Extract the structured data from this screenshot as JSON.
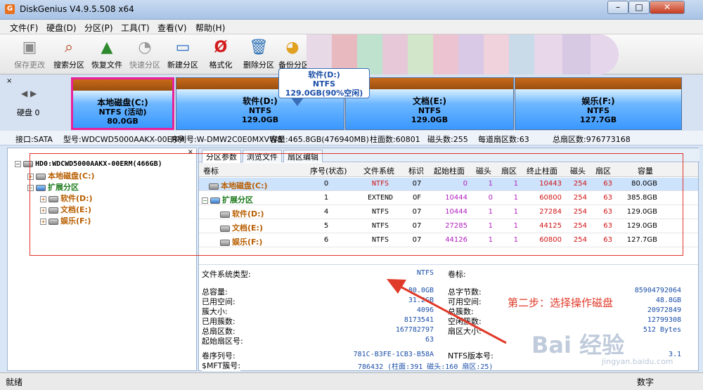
{
  "window": {
    "title": "DiskGenius V4.9.5.508 x64",
    "app_icon": "G",
    "minimize": "–",
    "maximize": "□",
    "close": "✕"
  },
  "menu": [
    "文件(F)",
    "硬盘(D)",
    "分区(P)",
    "工具(T)",
    "查看(V)",
    "帮助(H)"
  ],
  "toolbar": [
    {
      "label": "保存更改",
      "icon": "save-icon",
      "enabled": false
    },
    {
      "label": "搜索分区",
      "icon": "search-icon",
      "enabled": true
    },
    {
      "label": "恢复文件",
      "icon": "recover-file-icon",
      "enabled": true
    },
    {
      "label": "快速分区",
      "icon": "quick-partition-icon",
      "enabled": false
    },
    {
      "label": "新建分区",
      "icon": "new-partition-icon",
      "enabled": true
    },
    {
      "label": "格式化",
      "icon": "format-icon",
      "enabled": true
    },
    {
      "label": "删除分区",
      "icon": "delete-partition-icon",
      "enabled": true
    },
    {
      "label": "备份分区",
      "icon": "backup-partition-icon",
      "enabled": true
    }
  ],
  "disk_map": {
    "close": "×",
    "arrows": "◀ ▶",
    "disk_label": "硬盘 0",
    "partitions": [
      {
        "name": "本地磁盘(C:)",
        "fs": "NTFS (活动)",
        "size": "80.0GB",
        "selected": true
      },
      {
        "name": "软件(D:)",
        "fs": "NTFS",
        "size": "129.0GB",
        "selected": false
      },
      {
        "name": "文档(E:)",
        "fs": "NTFS",
        "size": "129.0GB",
        "selected": false
      },
      {
        "name": "娱乐(F:)",
        "fs": "NTFS",
        "size": "127.7GB",
        "selected": false
      }
    ],
    "tooltip": {
      "line1": "软件(D:)",
      "line2": "NTFS",
      "line3": "129.0GB(90%空闲)"
    }
  },
  "disk_info": {
    "iface": "接口:SATA",
    "model": "型号:WDCWD5000AAKX-00ERM",
    "serial": "序列号:W-DMW2C0E0MXVW8",
    "capacity": "容量:465.8GB(476940MB)",
    "cylinders": "柱面数:60801",
    "heads": "磁头数:255",
    "spt": "每道扇区数:63",
    "total_sectors": "总扇区数:976773168"
  },
  "tree": {
    "close": "×",
    "root": "HD0:WDCWD5000AAKX-00ERM(466GB)",
    "items": [
      {
        "label": "本地磁盘(C:)",
        "level": 1,
        "expander": "+"
      },
      {
        "label": "扩展分区",
        "level": 1,
        "expander": "−"
      },
      {
        "label": "软件(D:)",
        "level": 2,
        "expander": "+"
      },
      {
        "label": "文档(E:)",
        "level": 2,
        "expander": "+"
      },
      {
        "label": "娱乐(F:)",
        "level": 2,
        "expander": "+"
      }
    ]
  },
  "tabs": [
    "分区参数",
    "浏览文件",
    "扇区编辑"
  ],
  "grid": {
    "headers": [
      "卷标",
      "序号(状态)",
      "文件系统",
      "标识",
      "起始柱面",
      "磁头",
      "扇区",
      "终止柱面",
      "磁头",
      "扇区",
      "容量"
    ],
    "rows": [
      {
        "label": "本地磁盘(C:)",
        "indent": 0,
        "index": "0",
        "fs": "NTFS",
        "id": "07",
        "start_cyl": "0",
        "start_head": "1",
        "start_sec": "1",
        "end_cyl": "10443",
        "end_head": "254",
        "end_sec": "63",
        "size": "80.0GB",
        "selected": true
      },
      {
        "label": "扩展分区",
        "indent": 0,
        "index": "1",
        "fs": "EXTEND",
        "id": "0F",
        "start_cyl": "10444",
        "start_head": "0",
        "start_sec": "1",
        "end_cyl": "60800",
        "end_head": "254",
        "end_sec": "63",
        "size": "385.8GB",
        "selected": false
      },
      {
        "label": "软件(D:)",
        "indent": 1,
        "index": "4",
        "fs": "NTFS",
        "id": "07",
        "start_cyl": "10444",
        "start_head": "1",
        "start_sec": "1",
        "end_cyl": "27284",
        "end_head": "254",
        "end_sec": "63",
        "size": "129.0GB",
        "selected": false
      },
      {
        "label": "文档(E:)",
        "indent": 1,
        "index": "5",
        "fs": "NTFS",
        "id": "07",
        "start_cyl": "27285",
        "start_head": "1",
        "start_sec": "1",
        "end_cyl": "44125",
        "end_head": "254",
        "end_sec": "63",
        "size": "129.0GB",
        "selected": false
      },
      {
        "label": "娱乐(F:)",
        "indent": 1,
        "index": "6",
        "fs": "NTFS",
        "id": "07",
        "start_cyl": "44126",
        "start_head": "1",
        "start_sec": "1",
        "end_cyl": "60800",
        "end_head": "254",
        "end_sec": "63",
        "size": "127.7GB",
        "selected": false
      }
    ]
  },
  "details": {
    "fs_type_label": "文件系统类型:",
    "fs_type": "NTFS",
    "volume_label": "卷标:",
    "left": [
      {
        "k": "总容量:",
        "v": "80.0GB"
      },
      {
        "k": "已用空间:",
        "v": "31.2GB"
      },
      {
        "k": "簇大小:",
        "v": "4096"
      },
      {
        "k": "已用簇数:",
        "v": "8173541"
      },
      {
        "k": "总扇区数:",
        "v": "167782797"
      },
      {
        "k": "起始扇区号:",
        "v": "63"
      }
    ],
    "right": [
      {
        "k": "总字节数:",
        "v": "85904792064"
      },
      {
        "k": "可用空间:",
        "v": "48.8GB"
      },
      {
        "k": "总簇数:",
        "v": "20972849"
      },
      {
        "k": "空闲簇数:",
        "v": "12799308"
      },
      {
        "k": "扇区大小:",
        "v": "512 Bytes"
      }
    ],
    "serial_label": "卷序列号:",
    "serial": "781C-B3FE-1CB3-B58A",
    "ntfs_ver_label": "NTFS版本号:",
    "ntfs_ver": "3.1",
    "mft_label": "$MFT簇号:",
    "mft": "786432 (柱面:391 磁头:160 扇区:25)"
  },
  "annotation": {
    "note": "第二步：选择操作磁盘"
  },
  "watermark": {
    "brand": "Bai 经验",
    "url": "jingyan.baidu.com"
  },
  "status": {
    "left": "就绪",
    "right": "数字"
  },
  "colors": {
    "accent_pink": "#e8209a",
    "annotation_red": "#e03a2a",
    "value_blue": "#1a4ea8",
    "value_purple": "#b01fbf"
  }
}
